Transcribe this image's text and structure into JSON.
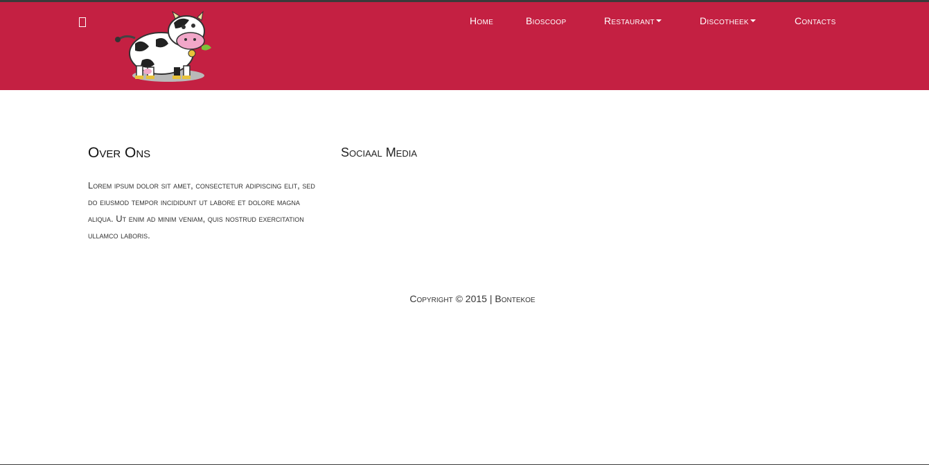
{
  "header": {
    "background": "#c42042",
    "toggle_icon": "menu-toggle-icon",
    "logo": "cow-mascot-logo"
  },
  "nav": {
    "items": [
      {
        "label": "Home",
        "dropdown": false
      },
      {
        "label": "Bioscoop",
        "dropdown": false
      },
      {
        "label": "Restaurant",
        "dropdown": true
      },
      {
        "label": "Discotheek",
        "dropdown": true
      },
      {
        "label": "Contacts",
        "dropdown": false
      }
    ]
  },
  "about": {
    "title": "Over Ons",
    "text": "Lorem ipsum dolor sit amet, consectetur adipiscing elit, sed do eiusmod tempor incididunt ut labore et dolore magna aliqua. Ut enim ad minim veniam, quis nostrud exercitation ullamco laboris."
  },
  "social": {
    "title": "Sociaal Media"
  },
  "footer": {
    "copyright": "Copyright © 2015 | Bontekoe"
  }
}
